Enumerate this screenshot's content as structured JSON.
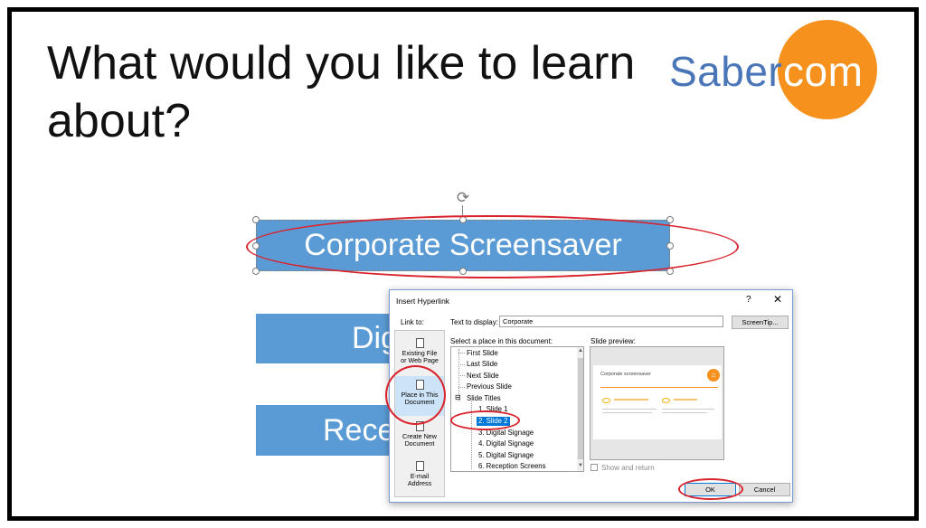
{
  "slide": {
    "title": "What would you like to learn about?",
    "logo": {
      "part1": "Saber",
      "part2": "com",
      "colors": {
        "blue": "#4a76b8",
        "orange": "#f7911d"
      }
    },
    "buttons": [
      {
        "label": "Corporate Screensaver",
        "color": "#5b9bd5"
      },
      {
        "label": "Digi"
      },
      {
        "label": "Rece"
      }
    ]
  },
  "dialog": {
    "title": "Insert Hyperlink",
    "help": "?",
    "close": "✕",
    "link_to_label": "Link to:",
    "text_to_display_label": "Text to display:",
    "text_to_display_value": "Corporate",
    "screentip_label": "ScreenTip...",
    "select_place_label": "Select a place in this document:",
    "slide_preview_label": "Slide preview:",
    "link_options": [
      {
        "label_line1": "Existing File",
        "label_line2": "or Web Page"
      },
      {
        "label_line1": "Place in This",
        "label_line2": "Document",
        "active": true
      },
      {
        "label_line1": "Create New",
        "label_line2": "Document"
      },
      {
        "label_line1": "E-mail",
        "label_line2": "Address"
      }
    ],
    "tree": [
      "First Slide",
      "Last Slide",
      "Next Slide",
      "Previous Slide",
      "Slide Titles",
      "1. Slide 1",
      "2. Slide 2",
      "3. Digital Signage",
      "4. Digital Signage",
      "5. Digital Signage",
      "6. Reception Screens"
    ],
    "preview_title": "Corporate screensaver",
    "show_and_return": "Show and return",
    "ok_label": "OK",
    "cancel_label": "Cancel",
    "accent_color": "#0078d7",
    "annotation_color": "#d9232d"
  }
}
